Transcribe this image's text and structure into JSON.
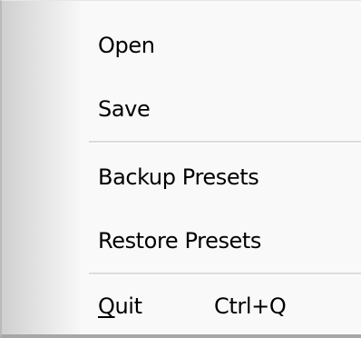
{
  "menu": {
    "items": [
      {
        "label": "Open"
      },
      {
        "label": "Save"
      },
      {
        "label": "Backup Presets"
      },
      {
        "label": "Restore Presets"
      },
      {
        "label_accel": "Q",
        "label_rest": "uit",
        "shortcut": "Ctrl+Q"
      }
    ]
  }
}
